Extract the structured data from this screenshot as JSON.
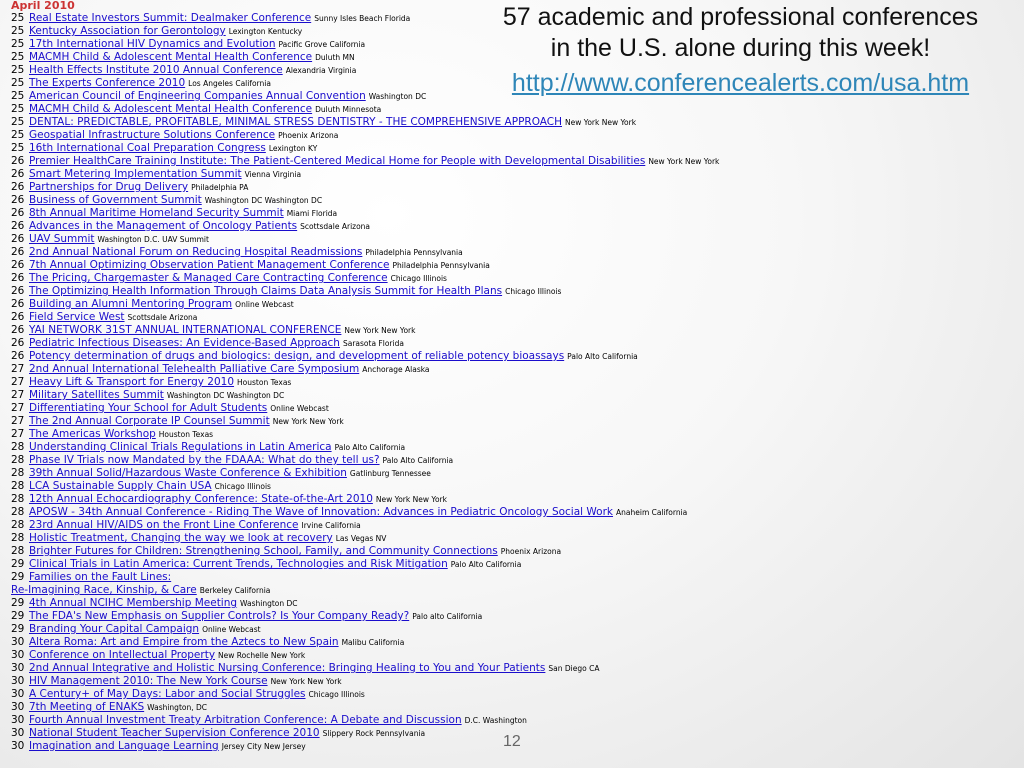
{
  "month_label": "April 2010",
  "headline": {
    "line1": "57 academic and professional conferences",
    "line2": "in the U.S. alone during this week!",
    "url": "http://www.conferencealerts.com/usa.htm"
  },
  "page_number": "12",
  "conferences": [
    {
      "day": "25",
      "title": "Real Estate Investors Summit: Dealmaker Conference",
      "location": "Sunny Isles Beach Florida"
    },
    {
      "day": "25",
      "title": "Kentucky Association for Gerontology",
      "location": "Lexington Kentucky"
    },
    {
      "day": "25",
      "title": "17th International HIV Dynamics and Evolution",
      "location": "Pacific Grove California"
    },
    {
      "day": "25",
      "title": "MACMH Child & Adolescent Mental Health Conference",
      "location": "Duluth MN"
    },
    {
      "day": "25",
      "title": "Health Effects Institute 2010 Annual Conference",
      "location": "Alexandria Virginia"
    },
    {
      "day": "25",
      "title": "The Experts Conference 2010",
      "location": "Los Angeles California"
    },
    {
      "day": "25",
      "title": "American Council of Engineering Companies Annual Convention",
      "location": "Washington DC"
    },
    {
      "day": "25",
      "title": "MACMH Child & Adolescent Mental Health Conference",
      "location": "Duluth Minnesota"
    },
    {
      "day": "25",
      "title": "DENTAL: PREDICTABLE, PROFITABLE, MINIMAL STRESS DENTISTRY - THE COMPREHENSIVE APPROACH",
      "location": "New York New York"
    },
    {
      "day": "25",
      "title": "Geospatial Infrastructure Solutions Conference",
      "location": "Phoenix Arizona"
    },
    {
      "day": "25",
      "title": "16th International Coal Preparation Congress",
      "location": "Lexington KY"
    },
    {
      "day": "26",
      "title": "Premier HealthCare Training Institute: The Patient-Centered Medical Home for People with Developmental Disabilities",
      "location": "New York New York"
    },
    {
      "day": "26",
      "title": "Smart Metering Implementation Summit",
      "location": "Vienna Virginia"
    },
    {
      "day": "26",
      "title": "Partnerships for Drug Delivery",
      "location": "Philadelphia PA"
    },
    {
      "day": "26",
      "title": "Business of Government Summit",
      "location": "Washington DC Washington DC"
    },
    {
      "day": "26",
      "title": "8th Annual Maritime Homeland Security Summit",
      "location": "Miami Florida"
    },
    {
      "day": "26",
      "title": "Advances in the Management of Oncology Patients",
      "location": "Scottsdale Arizona"
    },
    {
      "day": "26",
      "title": "UAV Summit",
      "location": "Washington D.C. UAV Summit"
    },
    {
      "day": "26",
      "title": "2nd Annual National Forum on Reducing Hospital Readmissions",
      "location": "Philadelphia Pennsylvania"
    },
    {
      "day": "26",
      "title": "7th Annual Optimizing Observation Patient Management Conference",
      "location": "Philadelphia Pennsylvania"
    },
    {
      "day": "26",
      "title": "The Pricing, Chargemaster & Managed Care Contracting Conference",
      "location": "Chicago Illinois"
    },
    {
      "day": "26",
      "title": "The Optimizing Health Information Through Claims Data Analysis Summit for Health Plans",
      "location": "Chicago Illinois"
    },
    {
      "day": "26",
      "title": "Building an Alumni Mentoring Program",
      "location": "Online Webcast"
    },
    {
      "day": "26",
      "title": "Field Service West",
      "location": "Scottsdale Arizona"
    },
    {
      "day": "26",
      "title": "YAI NETWORK 31ST ANNUAL INTERNATIONAL CONFERENCE",
      "location": "New York New York"
    },
    {
      "day": "26",
      "title": "Pediatric Infectious Diseases: An Evidence-Based Approach",
      "location": "Sarasota Florida"
    },
    {
      "day": "26",
      "title": "Potency determination of drugs and biologics: design, and development of reliable potency bioassays",
      "location": "Palo Alto California"
    },
    {
      "day": "27",
      "title": "2nd Annual International Telehealth Palliative Care Symposium",
      "location": "Anchorage Alaska"
    },
    {
      "day": "27",
      "title": "Heavy Lift & Transport for Energy 2010",
      "location": "Houston Texas"
    },
    {
      "day": "27",
      "title": "Military Satellites Summit",
      "location": "Washington DC Washington DC"
    },
    {
      "day": "27",
      "title": "Differentiating Your School for Adult Students",
      "location": "Online Webcast"
    },
    {
      "day": "27",
      "title": "The 2nd Annual Corporate IP Counsel Summit",
      "location": "New York New York"
    },
    {
      "day": "27",
      "title": "The Americas Workshop",
      "location": "Houston Texas"
    },
    {
      "day": "28",
      "title": "Understanding Clinical Trials Regulations in Latin America",
      "location": "Palo Alto California"
    },
    {
      "day": "28",
      "title": "Phase IV Trials now Mandated by the FDAAA: What do they tell us?",
      "location": "Palo Alto California"
    },
    {
      "day": "28",
      "title": "39th Annual Solid/Hazardous Waste Conference & Exhibition",
      "location": "Gatlinburg Tennessee"
    },
    {
      "day": "28",
      "title": "LCA Sustainable Supply Chain USA",
      "location": "Chicago Illinois"
    },
    {
      "day": "28",
      "title": "12th Annual Echocardiography Conference: State-of-the-Art 2010",
      "location": "New York New York"
    },
    {
      "day": "28",
      "title": "APOSW - 34th Annual Conference - Riding The Wave of Innovation: Advances in Pediatric Oncology Social Work",
      "location": "Anaheim California"
    },
    {
      "day": "28",
      "title": "23rd Annual HIV/AIDS on the Front Line Conference",
      "location": "Irvine California"
    },
    {
      "day": "28",
      "title": "Holistic Treatment, Changing the way we look at recovery",
      "location": "Las Vegas NV"
    },
    {
      "day": "28",
      "title": "Brighter Futures for Children: Strengthening School, Family, and Community Connections",
      "location": "Phoenix Arizona"
    },
    {
      "day": "29",
      "title": "Clinical Trials in Latin America: Current Trends, Technologies and Risk Mitigation",
      "location": "Palo Alto California"
    },
    {
      "day": "29",
      "title": "Families on the Fault Lines:",
      "location": ""
    },
    {
      "day": "",
      "title": "Re-Imagining Race, Kinship, & Care",
      "location": "Berkeley California"
    },
    {
      "day": "29",
      "title": "4th Annual NCIHC Membership Meeting",
      "location": "Washington DC"
    },
    {
      "day": "29",
      "title": "The FDA's New Emphasis on Supplier Controls? Is Your Company Ready?",
      "location": "Palo alto California"
    },
    {
      "day": "29",
      "title": "Branding Your Capital Campaign",
      "location": "Online Webcast"
    },
    {
      "day": "30",
      "title": "Altera Roma: Art and Empire from the Aztecs to New Spain",
      "location": "Malibu California"
    },
    {
      "day": "30",
      "title": "Conference on Intellectual Property",
      "location": "New Rochelle New York"
    },
    {
      "day": "30",
      "title": "2nd Annual Integrative and Holistic Nursing Conference: Bringing Healing to You and Your Patients",
      "location": "San Diego CA"
    },
    {
      "day": "30",
      "title": "HIV Management 2010: The New York Course",
      "location": "New York New York"
    },
    {
      "day": "30",
      "title": "A Century+ of May Days: Labor and Social Struggles",
      "location": "Chicago Illinois"
    },
    {
      "day": "30",
      "title": "7th Meeting of ENAKS",
      "location": "Washington, DC"
    },
    {
      "day": "30",
      "title": "Fourth Annual Investment Treaty Arbitration Conference: A Debate and Discussion",
      "location": "D.C. Washington"
    },
    {
      "day": "30",
      "title": "National Student Teacher Supervision Conference 2010",
      "location": "Slippery Rock Pennsylvania"
    },
    {
      "day": "30",
      "title": "Imagination and Language Learning",
      "location": "Jersey City New Jersey"
    }
  ]
}
